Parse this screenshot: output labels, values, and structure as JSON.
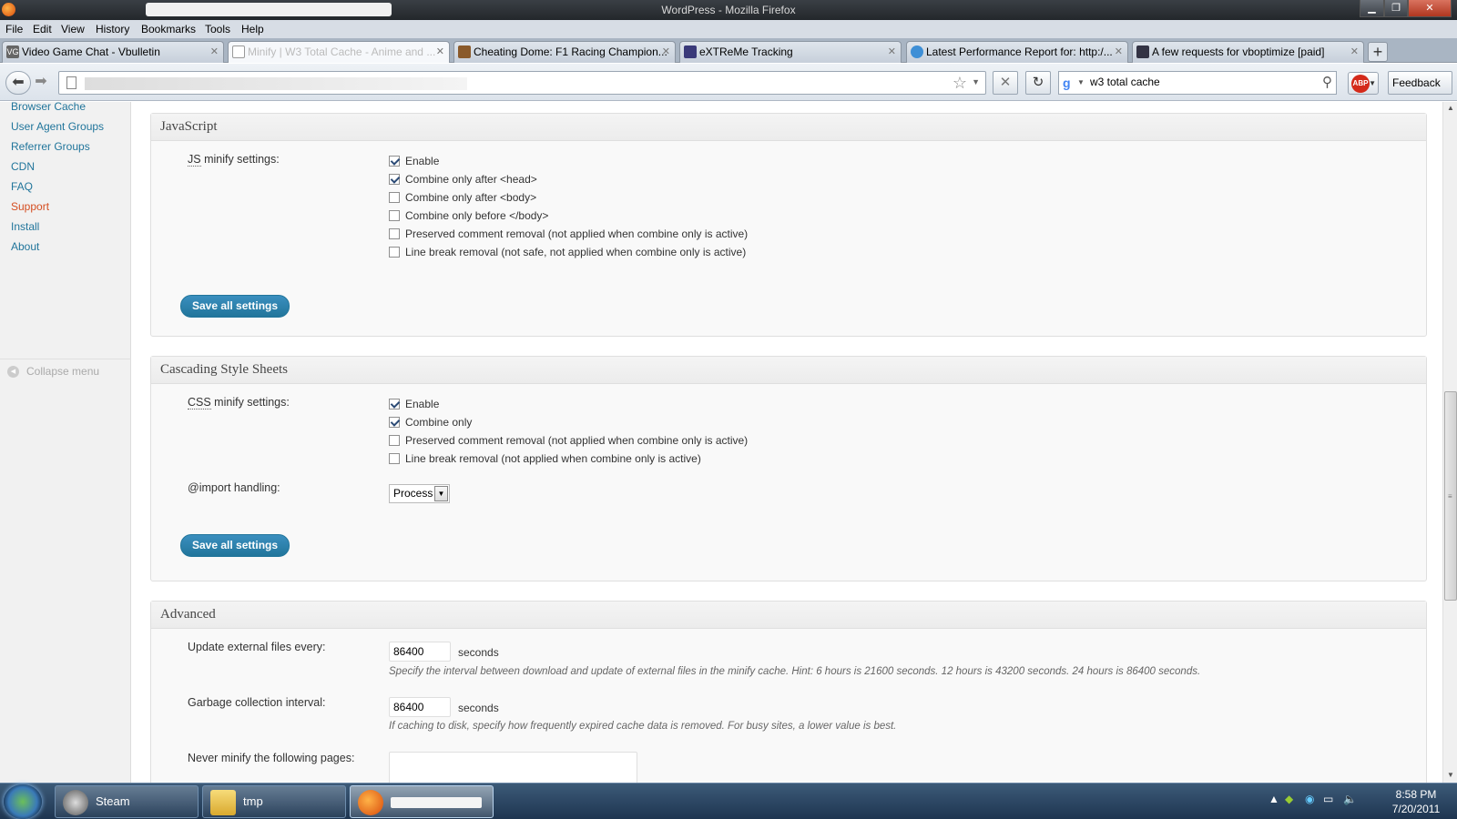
{
  "window": {
    "title": "WordPress - Mozilla Firefox",
    "min": "▁",
    "max": "❐",
    "close": "✕"
  },
  "menu": [
    "File",
    "Edit",
    "View",
    "History",
    "Bookmarks",
    "Tools",
    "Help"
  ],
  "tabs": [
    {
      "label": "Video Game Chat - Vbulletin",
      "icon": "vg-icon"
    },
    {
      "label": "Minify | W3 Total Cache - Anime and ...",
      "icon": "page-icon"
    },
    {
      "label": "Cheating Dome: F1 Racing Champion...",
      "icon": "cheating-dome-icon"
    },
    {
      "label": "eXTReMe Tracking",
      "icon": "extreme-icon"
    },
    {
      "label": "Latest Performance Report for: http:/...",
      "icon": "report-icon"
    },
    {
      "label": "A few requests for vboptimize [paid]",
      "icon": "vb-icon"
    }
  ],
  "tab_close": "✕",
  "new_tab": "+",
  "nav": {
    "search_value": "w3 total cache",
    "feedback": "Feedback",
    "abp": "ABP"
  },
  "sidebar": {
    "items": [
      "Browser Cache",
      "User Agent Groups",
      "Referrer Groups",
      "CDN",
      "FAQ",
      "Support",
      "Install",
      "About"
    ],
    "collapse": "Collapse menu"
  },
  "js": {
    "title": "JavaScript",
    "label_abbr": "JS",
    "label_rest": " minify settings:",
    "options": [
      {
        "label": "Enable",
        "checked": true
      },
      {
        "label": "Combine only after <head>",
        "checked": true
      },
      {
        "label": "Combine only after <body>",
        "checked": false
      },
      {
        "label": "Combine only before </body>",
        "checked": false
      },
      {
        "label": "Preserved comment removal (not applied when combine only is active)",
        "checked": false
      },
      {
        "label": "Line break removal (not safe, not applied when combine only is active)",
        "checked": false
      }
    ],
    "save": "Save all settings"
  },
  "css": {
    "title": "Cascading Style Sheets",
    "label_abbr": "CSS",
    "label_rest": " minify settings:",
    "options": [
      {
        "label": "Enable",
        "checked": true
      },
      {
        "label": "Combine only",
        "checked": true
      },
      {
        "label": "Preserved comment removal (not applied when combine only is active)",
        "checked": false
      },
      {
        "label": "Line break removal (not applied when combine only is active)",
        "checked": false
      }
    ],
    "import_label": "@import handling:",
    "import_value": "Process",
    "save": "Save all settings"
  },
  "advanced": {
    "title": "Advanced",
    "update_label": "Update external files every:",
    "update_value": "86400",
    "update_unit": "seconds",
    "update_hint": "Specify the interval between download and update of external files in the minify cache. Hint: 6 hours is 21600 seconds. 12 hours is 43200 seconds. 24 hours is 86400 seconds.",
    "gc_label": "Garbage collection interval:",
    "gc_value": "86400",
    "gc_unit": "seconds",
    "gc_hint": "If caching to disk, specify how frequently expired cache data is removed. For busy sites, a lower value is best.",
    "never_label": "Never minify the following pages:"
  },
  "taskbar": {
    "items": [
      {
        "label": "Steam"
      },
      {
        "label": "tmp"
      },
      {
        "label": ""
      }
    ],
    "time": "8:58 PM",
    "date": "7/20/2011"
  }
}
